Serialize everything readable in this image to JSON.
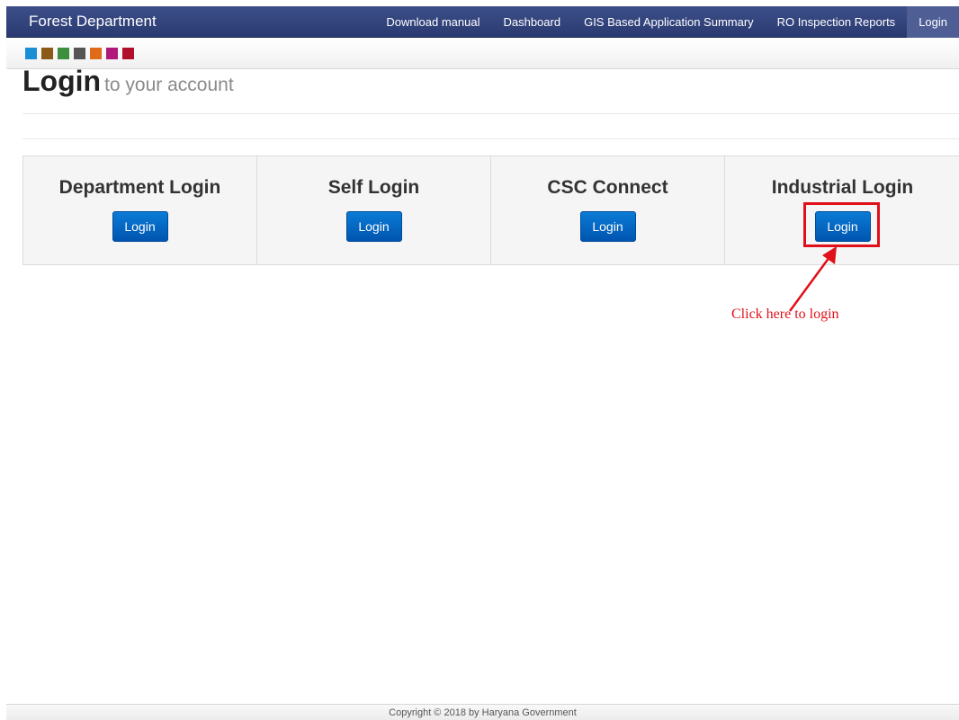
{
  "header": {
    "brand": "Forest Department",
    "nav": [
      "Download manual",
      "Dashboard",
      "GIS Based Application Summary",
      "RO Inspection Reports",
      "Login"
    ],
    "active": "Login"
  },
  "theme_swatches": [
    "#1a8fd6",
    "#8a5a16",
    "#3d8f3d",
    "#555555",
    "#e06a1a",
    "#b0187a",
    "#b0102a"
  ],
  "page": {
    "title": "Login",
    "subtitle": "to your account"
  },
  "cards": [
    {
      "title": "Department Login",
      "button": "Login"
    },
    {
      "title": "Self Login",
      "button": "Login"
    },
    {
      "title": "CSC Connect",
      "button": "Login"
    },
    {
      "title": "Industrial Login",
      "button": "Login"
    }
  ],
  "annotation": {
    "text": "Click here to login",
    "color": "#e0101a"
  },
  "footer": {
    "copyright": "Copyright © 2018 by Haryana Government"
  }
}
